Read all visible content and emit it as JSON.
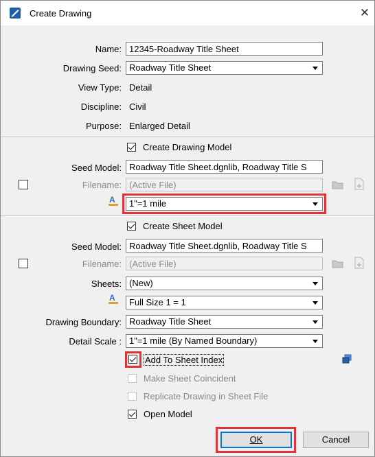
{
  "window": {
    "title": "Create Drawing",
    "close_glyph": "✕"
  },
  "fields": {
    "name_label": "Name:",
    "name_value": "12345-Roadway Title Sheet",
    "drawing_seed_label": "Drawing Seed:",
    "drawing_seed_value": "Roadway Title Sheet",
    "view_type_label": "View Type:",
    "view_type_value": "Detail",
    "discipline_label": "Discipline:",
    "discipline_value": "Civil",
    "purpose_label": "Purpose:",
    "purpose_value": "Enlarged Detail"
  },
  "drawing_model": {
    "create_label": "Create Drawing Model",
    "create_checked": true,
    "seed_model_label": "Seed Model:",
    "seed_model_value": "Roadway Title Sheet.dgnlib, Roadway Title S",
    "filename_label": "Filename:",
    "filename_placeholder": "(Active File)",
    "annotation_scale_value": "1\"=1 mile"
  },
  "sheet_model": {
    "create_label": "Create Sheet Model",
    "create_checked": true,
    "seed_model_label": "Seed Model:",
    "seed_model_value": "Roadway Title Sheet.dgnlib, Roadway Title S",
    "filename_label": "Filename:",
    "filename_placeholder": "(Active File)",
    "sheets_label": "Sheets:",
    "sheets_value": "(New)",
    "annotation_scale_value": "Full Size 1 = 1",
    "drawing_boundary_label": "Drawing Boundary:",
    "drawing_boundary_value": "Roadway Title Sheet",
    "detail_scale_label": "Detail Scale :",
    "detail_scale_value": "1\"=1 mile (By Named Boundary)"
  },
  "options": {
    "add_to_sheet_index": "Add To Sheet Index",
    "make_sheet_coincident": "Make Sheet Coincident",
    "replicate_drawing": "Replicate Drawing in Sheet File",
    "open_model": "Open Model"
  },
  "buttons": {
    "ok": "OK",
    "cancel": "Cancel"
  },
  "colors": {
    "highlight": "#e0343a",
    "accent": "#0078d7"
  }
}
